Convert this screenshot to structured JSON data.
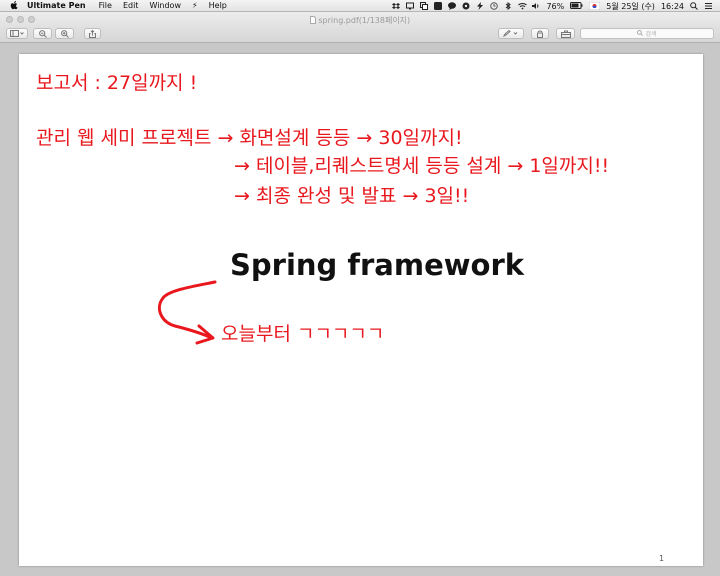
{
  "menubar": {
    "app_name": "Ultimate Pen",
    "items": [
      "File",
      "Edit",
      "Window",
      "Help"
    ],
    "battery": "76%",
    "date": "5월 25일 (수)",
    "time": "16:24"
  },
  "window": {
    "title": "spring.pdf(1/138페이지)",
    "search_placeholder": "검색"
  },
  "page": {
    "lines": [
      "보고서 : 27일까지 !",
      "관리 웹 세미 프로젝트 → 화면설계 등등 → 30일까지!",
      "→ 테이블,리퀘스트명세 등등 설계 → 1일까지!!",
      "→ 최종 완성 및 발표 → 3일!!"
    ],
    "heading": "Spring framework",
    "note": "오늘부터 ㄱㄱㄱㄱㄱ",
    "page_number": "1"
  },
  "colors": {
    "handwriting": "#e8181e",
    "heading": "#111111"
  }
}
